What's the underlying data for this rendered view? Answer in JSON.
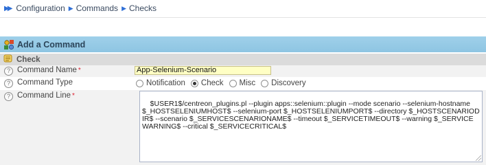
{
  "breadcrumb": {
    "items": [
      "Configuration",
      "Commands",
      "Checks"
    ]
  },
  "section": {
    "title": "Add a Command"
  },
  "subsection": {
    "title": "Check"
  },
  "form": {
    "command_name": {
      "label": "Command Name",
      "required_mark": "*",
      "value": "App-Selenium-Scenario"
    },
    "command_type": {
      "label": "Command Type",
      "options": [
        "Notification",
        "Check",
        "Misc",
        "Discovery"
      ],
      "selected": "Check"
    },
    "command_line": {
      "label": "Command Line",
      "required_mark": "*",
      "value": "$USER1$/centreon_plugins.pl --plugin apps::selenium::plugin --mode scenario --selenium-hostname $_HOSTSELENIUMHOST$ --selenium-port $_HOSTSELENIUMPORT$ --directory $_HOSTSCENARIODIR$ --scenario $_SERVICESCENARIONAME$ --timeout $_SERVICETIMEOUT$ --warning $_SERVICEWARNING$ --critical $_SERVICECRITICAL$"
    },
    "help_glyph": "?"
  },
  "colors": {
    "section_header": "#8ec5e2",
    "subheader": "#dbdbdb",
    "name_input_bg": "#ffffc4",
    "link_blue": "#2f6fd6"
  }
}
